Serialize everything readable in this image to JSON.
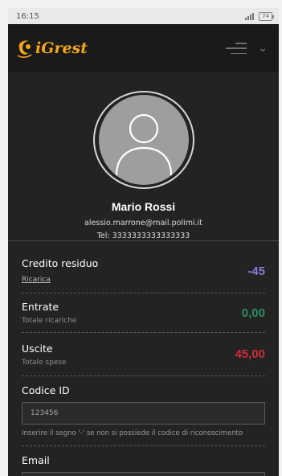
{
  "status_bar": {
    "time": "16:15",
    "battery": "74"
  },
  "header": {
    "logo_text": "iGrest"
  },
  "profile": {
    "name": "Mario Rossi",
    "email": "alessio.marrone@mail.polimi.it",
    "tel": "Tel: 3333333333333333"
  },
  "credito": {
    "title": "Credito residuo",
    "link": "Ricarica",
    "value": "-45"
  },
  "entrate": {
    "title": "Entrate",
    "subtitle": "Totale ricariche",
    "value": "0,00"
  },
  "uscite": {
    "title": "Uscite",
    "subtitle": "Totale spese",
    "value": "45,00"
  },
  "codice": {
    "label": "Codice ID",
    "value": "123456",
    "hint": "Inserire il segno '-' se non si possiede il codice di riconoscimento"
  },
  "email_field": {
    "label": "Email"
  },
  "colors": {
    "accent": "#f5a814",
    "credit": "#8b7cd6",
    "income": "#2e8f60",
    "expense": "#d02a3a",
    "background": "#232323"
  }
}
